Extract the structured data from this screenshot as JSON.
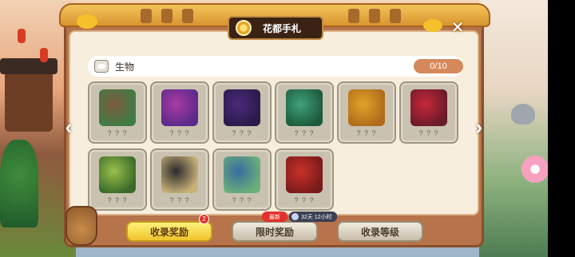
{
  "panel": {
    "title": "花都手札",
    "close_symbol": "✕"
  },
  "section": {
    "label": "生物",
    "progress": "0/10"
  },
  "cards": [
    {
      "name": "? ? ?",
      "art": "mushroom-creature",
      "color1": "#7d5a3c",
      "color2": "#3f7d46"
    },
    {
      "name": "? ? ?",
      "art": "pink-serpent",
      "color1": "#a83aa0",
      "color2": "#5a2a8c"
    },
    {
      "name": "? ? ?",
      "art": "purple-beast",
      "color1": "#4a2a7a",
      "color2": "#2a1a4a"
    },
    {
      "name": "? ? ?",
      "art": "green-leaf-spirit",
      "color1": "#3fa07a",
      "color2": "#1d5a3c"
    },
    {
      "name": "? ? ?",
      "art": "golden-flower",
      "color1": "#e0a42a",
      "color2": "#b06a1a"
    },
    {
      "name": "? ? ?",
      "art": "red-rose",
      "color1": "#c8283a",
      "color2": "#6a1a2a"
    },
    {
      "name": "? ? ?",
      "art": "green-vine",
      "color1": "#9ac04a",
      "color2": "#3a6a2a"
    },
    {
      "name": "? ? ?",
      "art": "masked-figure",
      "color1": "#2a2a2a",
      "color2": "#c9b27a"
    },
    {
      "name": "? ? ?",
      "art": "blue-green-plant",
      "color1": "#3a6aa0",
      "color2": "#6ab07a"
    },
    {
      "name": "? ? ?",
      "art": "red-peony",
      "color1": "#c8322a",
      "color2": "#7a1a1a"
    }
  ],
  "buttons": {
    "collect": "收录奖励",
    "limited": "限时奖励",
    "level": "收录等级"
  },
  "badges": {
    "collect_count": "2",
    "new": "最新",
    "timer": "32天 12小时"
  },
  "nav": {
    "prev": "‹",
    "next": "›"
  }
}
